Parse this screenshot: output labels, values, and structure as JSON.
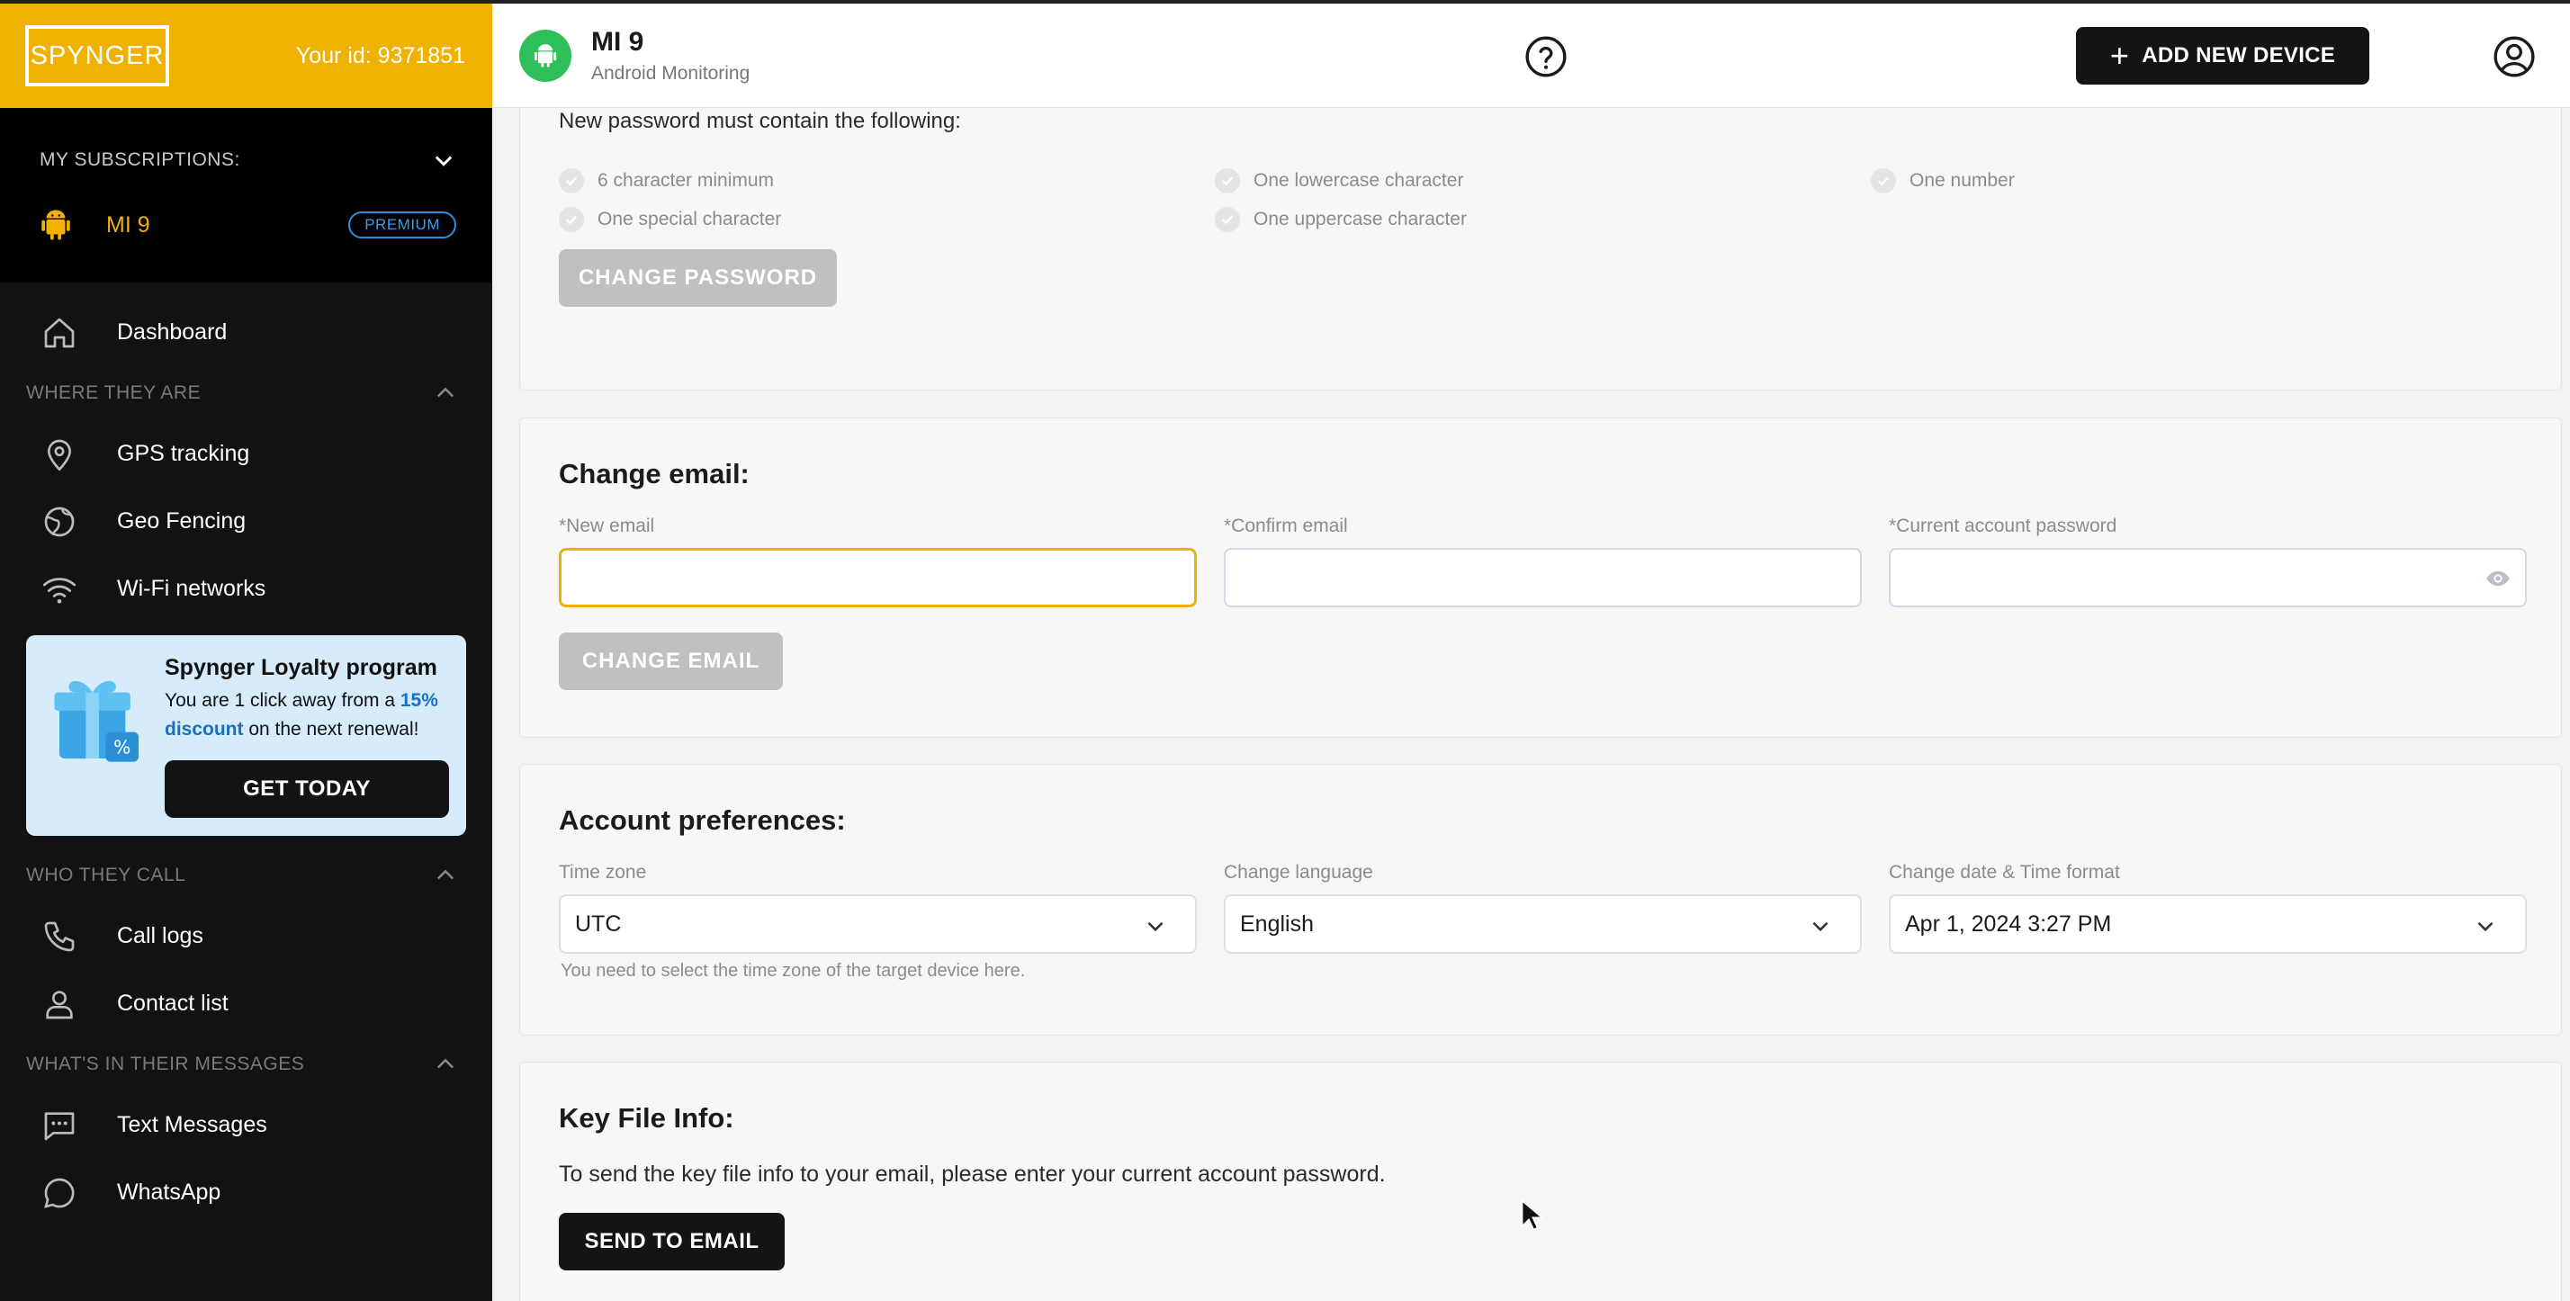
{
  "brand": {
    "logo": "SPYNGER",
    "user_id": "Your id: 9371851"
  },
  "subscriptions": {
    "label": "MY SUBSCRIPTIONS:",
    "device_name": "MI 9",
    "badge": "PREMIUM"
  },
  "nav": {
    "dashboard": "Dashboard",
    "section_where": "WHERE THEY ARE",
    "gps": "GPS tracking",
    "geo": "Geo Fencing",
    "wifi": "Wi-Fi networks",
    "section_call": "WHO THEY CALL",
    "call_logs": "Call logs",
    "contact_list": "Contact list",
    "section_messages": "WHAT'S IN THEIR MESSAGES",
    "text_messages": "Text Messages",
    "whatsapp": "WhatsApp"
  },
  "loyalty": {
    "title": "Spynger Loyalty program",
    "desc_pre": "You are 1 click away from a ",
    "desc_highlight": "15% discount",
    "desc_post": " on the next renewal!",
    "button": "GET TODAY"
  },
  "header": {
    "device_title": "MI 9",
    "device_subtitle": "Android Monitoring",
    "add_button": "ADD NEW DEVICE"
  },
  "password": {
    "requirements_title": "New password must contain the following:",
    "req": [
      "6 character minimum",
      "One lowercase character",
      "One number",
      "One special character",
      "One uppercase character"
    ],
    "button": "CHANGE PASSWORD"
  },
  "email": {
    "title": "Change email:",
    "new_email_label": "*New email",
    "new_email_value": "",
    "confirm_email_label": "*Confirm email",
    "confirm_email_value": "",
    "current_password_label": "*Current account password",
    "current_password_value": "",
    "button": "CHANGE EMAIL"
  },
  "preferences": {
    "title": "Account preferences:",
    "timezone_label": "Time zone",
    "timezone_value": "UTC",
    "timezone_hint": "You need to select the time zone of the target device here.",
    "language_label": "Change language",
    "language_value": "English",
    "datetime_label": "Change date & Time format",
    "datetime_value": "Apr 1, 2024 3:27 PM"
  },
  "keyfile": {
    "title": "Key File Info:",
    "description": "To send the key file info to your email, please enter your current account password.",
    "button": "SEND TO EMAIL"
  },
  "colors": {
    "brand": "#f0b100",
    "sidebar": "#121212",
    "accent_link": "#1a6fc0",
    "android_green": "#2fbf5a"
  }
}
